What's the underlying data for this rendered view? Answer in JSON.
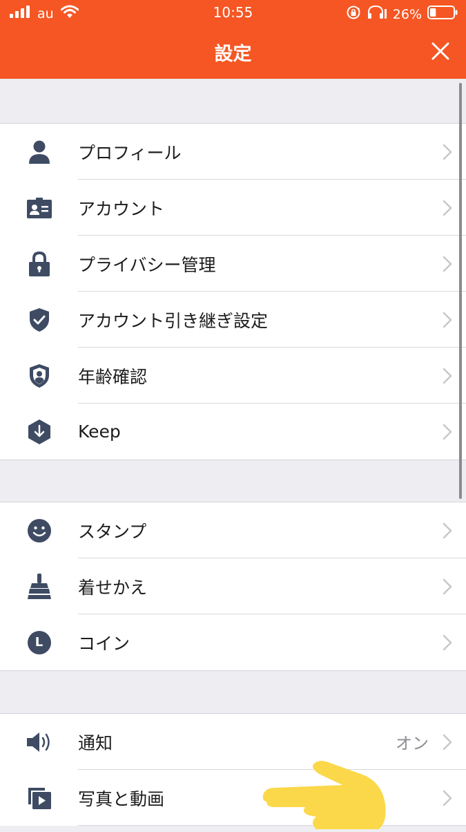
{
  "status_bar": {
    "carrier": "au",
    "time": "10:55",
    "battery_percent": "26%",
    "battery_level": 0.26
  },
  "nav": {
    "title": "設定",
    "close_icon": "close-icon"
  },
  "sections": [
    {
      "items": [
        {
          "label": "プロフィール",
          "icon": "person-icon"
        },
        {
          "label": "アカウント",
          "icon": "id-card-icon"
        },
        {
          "label": "プライバシー管理",
          "icon": "lock-icon"
        },
        {
          "label": "アカウント引き継ぎ設定",
          "icon": "shield-check-icon"
        },
        {
          "label": "年齢確認",
          "icon": "shield-person-icon"
        },
        {
          "label": "Keep",
          "icon": "keep-download-icon"
        }
      ]
    },
    {
      "items": [
        {
          "label": "スタンプ",
          "icon": "smiley-icon"
        },
        {
          "label": "着せかえ",
          "icon": "brush-icon"
        },
        {
          "label": "コイン",
          "icon": "coin-icon",
          "icon_letter": "L"
        }
      ]
    },
    {
      "items": [
        {
          "label": "通知",
          "icon": "speaker-icon",
          "value": "オン"
        },
        {
          "label": "写真と動画",
          "icon": "photo-video-icon"
        }
      ]
    }
  ],
  "colors": {
    "accent": "#f55623",
    "icon": "#3e4b63",
    "chevron": "#c7c7cc",
    "pointer": "#fbd84a"
  }
}
